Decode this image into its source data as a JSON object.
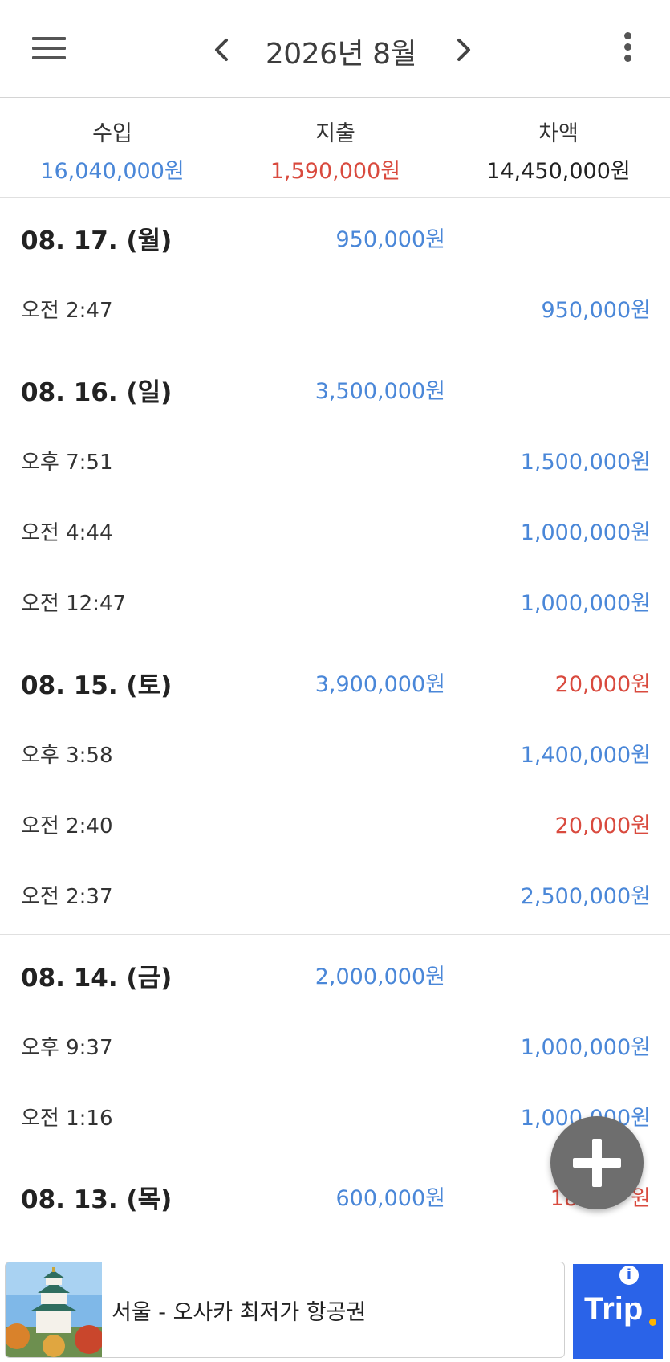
{
  "header": {
    "title": "2026년 8월",
    "menu_icon": "hamburger-menu-icon",
    "prev_icon": "chevron-left-icon",
    "next_icon": "chevron-right-icon",
    "more_icon": "more-vertical-icon"
  },
  "summary": {
    "income_label": "수입",
    "income_value": "16,040,000원",
    "expense_label": "지출",
    "expense_value": "1,590,000원",
    "balance_label": "차액",
    "balance_value": "14,450,000원"
  },
  "days": [
    {
      "date": "08. 17. (월)",
      "income": "950,000원",
      "expense": "",
      "transactions": [
        {
          "time": "오전 2:47",
          "amount": "950,000원",
          "type": "income"
        }
      ]
    },
    {
      "date": "08. 16. (일)",
      "income": "3,500,000원",
      "expense": "",
      "transactions": [
        {
          "time": "오후 7:51",
          "amount": "1,500,000원",
          "type": "income"
        },
        {
          "time": "오전 4:44",
          "amount": "1,000,000원",
          "type": "income"
        },
        {
          "time": "오전 12:47",
          "amount": "1,000,000원",
          "type": "income"
        }
      ]
    },
    {
      "date": "08. 15. (토)",
      "income": "3,900,000원",
      "expense": "20,000원",
      "transactions": [
        {
          "time": "오후 3:58",
          "amount": "1,400,000원",
          "type": "income"
        },
        {
          "time": "오전 2:40",
          "amount": "20,000원",
          "type": "expense"
        },
        {
          "time": "오전 2:37",
          "amount": "2,500,000원",
          "type": "income"
        }
      ]
    },
    {
      "date": "08. 14. (금)",
      "income": "2,000,000원",
      "expense": "",
      "transactions": [
        {
          "time": "오후 9:37",
          "amount": "1,000,000원",
          "type": "income"
        },
        {
          "time": "오전 1:16",
          "amount": "1,000,000원",
          "type": "income"
        }
      ]
    },
    {
      "date": "08. 13. (목)",
      "income": "600,000원",
      "expense": "18",
      "expense_tail": "원",
      "transactions": []
    }
  ],
  "fab": {
    "icon": "plus-icon"
  },
  "ad": {
    "text": "서울 - 오사카 최저가 항공권",
    "logo_text": "Trip",
    "info_icon": "info-icon",
    "info_glyph": "i",
    "more_icon": "ad-options-icon",
    "image_icon": "osaka-castle-image"
  },
  "colors": {
    "income": "#4a87d8",
    "expense": "#d94a3e",
    "fab": "#6e6e6e",
    "ad_brand": "#2a63e8"
  }
}
